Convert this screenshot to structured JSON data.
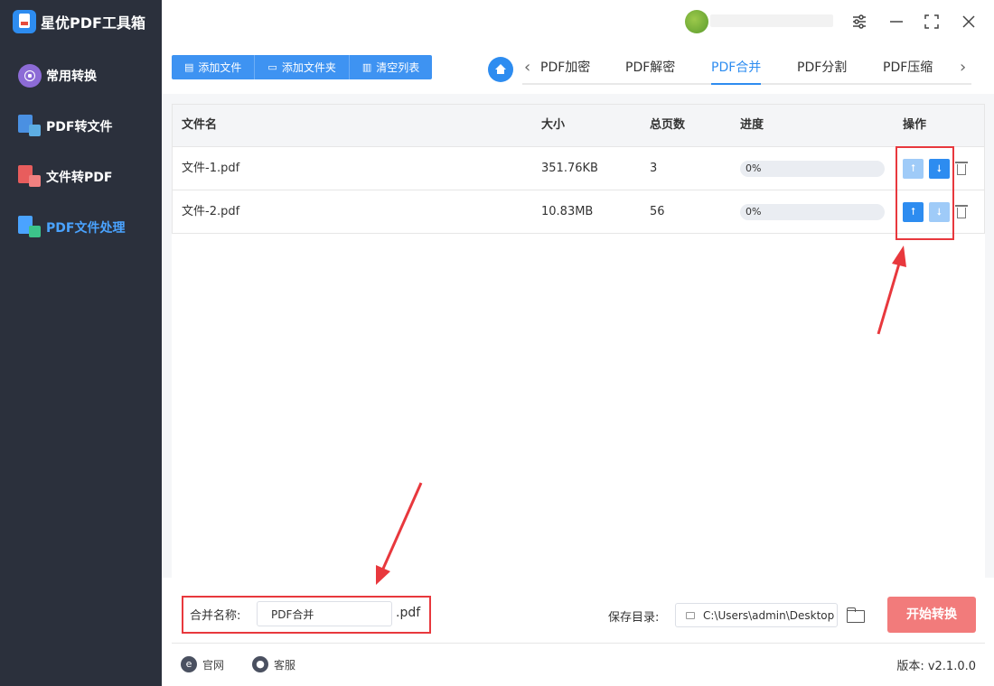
{
  "app": {
    "title": "星优PDF工具箱"
  },
  "sidebar": {
    "items": [
      {
        "label": "常用转换",
        "icon": "grid-circle-icon",
        "active": false
      },
      {
        "label": "PDF转文件",
        "icon": "pdf-to-file-icon",
        "active": false
      },
      {
        "label": "文件转PDF",
        "icon": "file-to-pdf-icon",
        "active": false
      },
      {
        "label": "PDF文件处理",
        "icon": "pdf-process-icon",
        "active": true
      }
    ]
  },
  "window_controls": {
    "settings": "settings-sliders-icon",
    "minimize": "minimize-icon",
    "maximize": "maximize-icon",
    "close": "close-icon"
  },
  "toolbar": {
    "add_file": "添加文件",
    "add_folder": "添加文件夹",
    "clear_list": "清空列表"
  },
  "tabs": {
    "items": [
      "PDF加密",
      "PDF解密",
      "PDF合并",
      "PDF分割",
      "PDF压缩"
    ],
    "active": "PDF合并"
  },
  "table": {
    "headers": {
      "name": "文件名",
      "size": "大小",
      "pages": "总页数",
      "progress": "进度",
      "actions": "操作"
    },
    "rows": [
      {
        "name": "文件-1.pdf",
        "size": "351.76KB",
        "pages": "3",
        "progress": "0%"
      },
      {
        "name": "文件-2.pdf",
        "size": "10.83MB",
        "pages": "56",
        "progress": "0%"
      }
    ]
  },
  "bottom": {
    "merge_name_label": "合并名称:",
    "merge_name_value": "PDF合并",
    "merge_ext": ".pdf",
    "save_dir_label": "保存目录:",
    "save_dir_value": "C:\\Users\\admin\\Desktop",
    "start_button": "开始转换"
  },
  "footer": {
    "website": "官网",
    "support": "客服",
    "version": "版本: v2.1.0.0"
  },
  "colors": {
    "accent": "#2d8cf0",
    "sidebar_bg": "#2b303c",
    "start_button": "#f27b7b",
    "annotation": "#e8383d"
  }
}
